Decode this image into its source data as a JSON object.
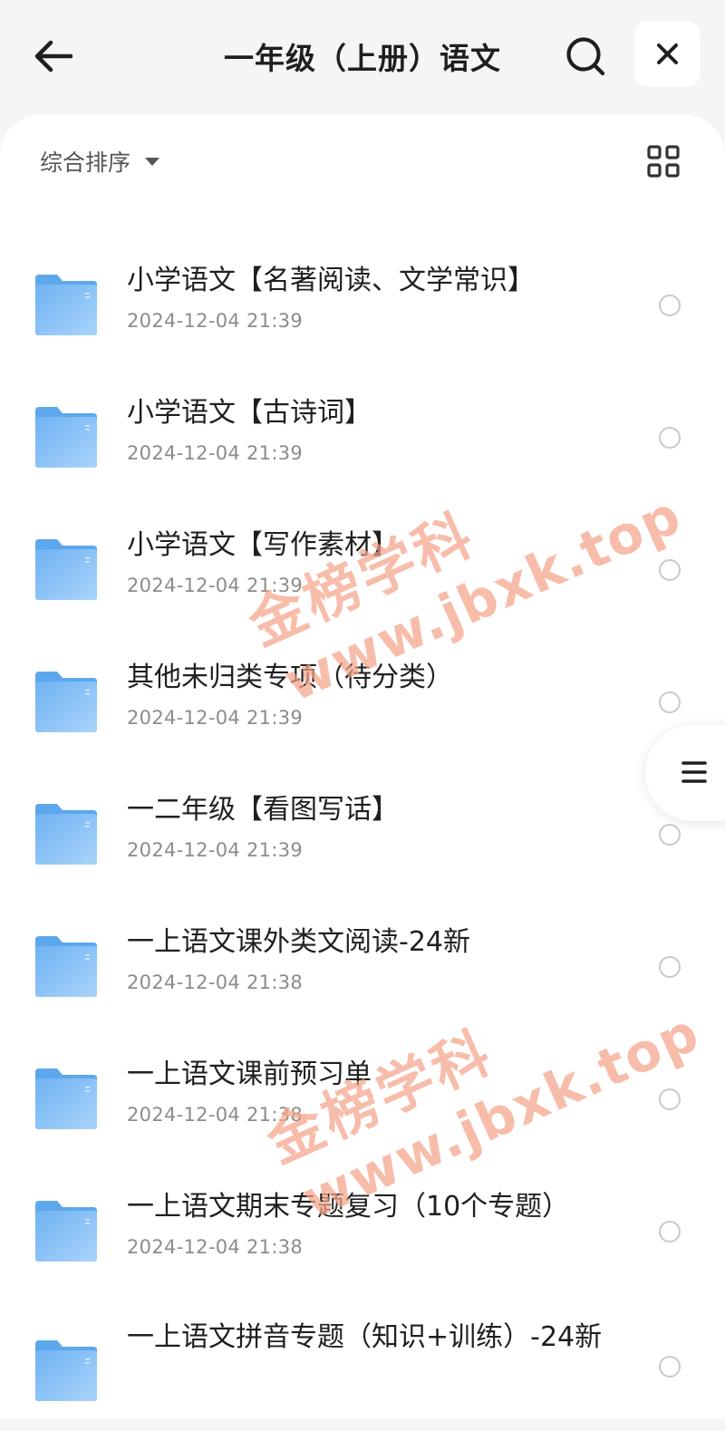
{
  "header": {
    "title": "一年级（上册）语文"
  },
  "toolbar": {
    "sort_label": "综合排序"
  },
  "files": [
    {
      "name": "小学语文【名著阅读、文学常识】",
      "date": "2024-12-04 21:39"
    },
    {
      "name": "小学语文【古诗词】",
      "date": "2024-12-04 21:39"
    },
    {
      "name": "小学语文【写作素材】",
      "date": "2024-12-04 21:39"
    },
    {
      "name": "其他未归类专项（待分类）",
      "date": "2024-12-04 21:39"
    },
    {
      "name": "一二年级【看图写话】",
      "date": "2024-12-04 21:39"
    },
    {
      "name": "一上语文课外类文阅读-24新",
      "date": "2024-12-04 21:38"
    },
    {
      "name": "一上语文课前预习单",
      "date": "2024-12-04 21:38"
    },
    {
      "name": "一上语文期末专题复习（10个专题）",
      "date": "2024-12-04 21:38"
    },
    {
      "name": "一上语文拼音专题（知识+训练）-24新",
      "date": ""
    }
  ],
  "watermarks": [
    {
      "line1": "金榜学科",
      "line2": "www.jbxk.top"
    },
    {
      "line1": "金榜学科",
      "line2": "www.jbxk.top"
    }
  ],
  "icons": {
    "back": "arrow-left-icon",
    "search": "search-icon",
    "close": "close-icon",
    "sort": "caret-down-icon",
    "view": "grid-view-icon",
    "folder": "folder-icon",
    "menu": "menu-icon"
  },
  "colors": {
    "folder": "#7fbef5",
    "accent": "#3a9cf0",
    "watermark": "#f4a58a"
  }
}
